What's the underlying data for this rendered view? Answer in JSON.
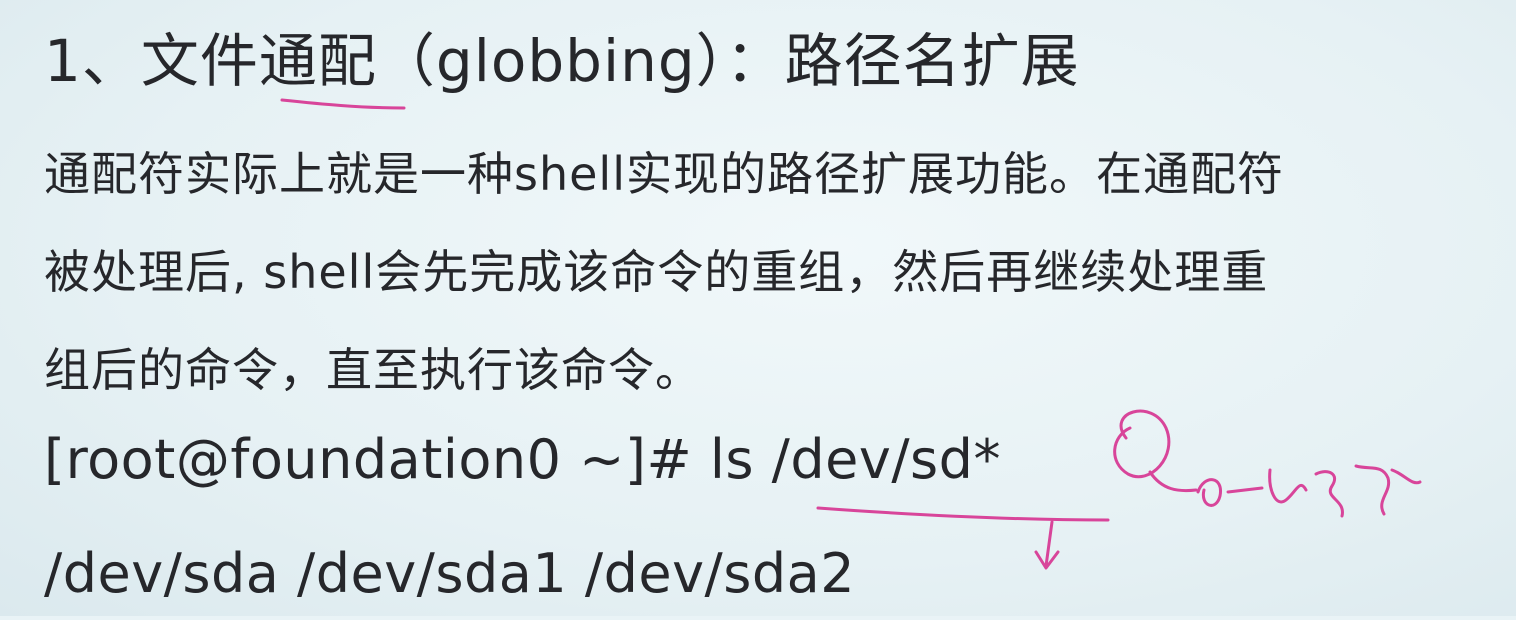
{
  "heading": "1、文件通配（globbing）：路径名扩展",
  "paragraph": {
    "line1": "通配符实际上就是一种shell实现的路径扩展功能。在通配符",
    "line2": "被处理后, shell会先完成该命令的重组，然后再继续处理重",
    "line3": "组后的命令，直至执行该命令。"
  },
  "command": "[root@foundation0 ~]# ls /dev/sd*",
  "output": "/dev/sda  /dev/sda1  /dev/sda2",
  "colors": {
    "background": "#e9f3f6",
    "text": "#26272b",
    "annotation": "#d8459a"
  }
}
